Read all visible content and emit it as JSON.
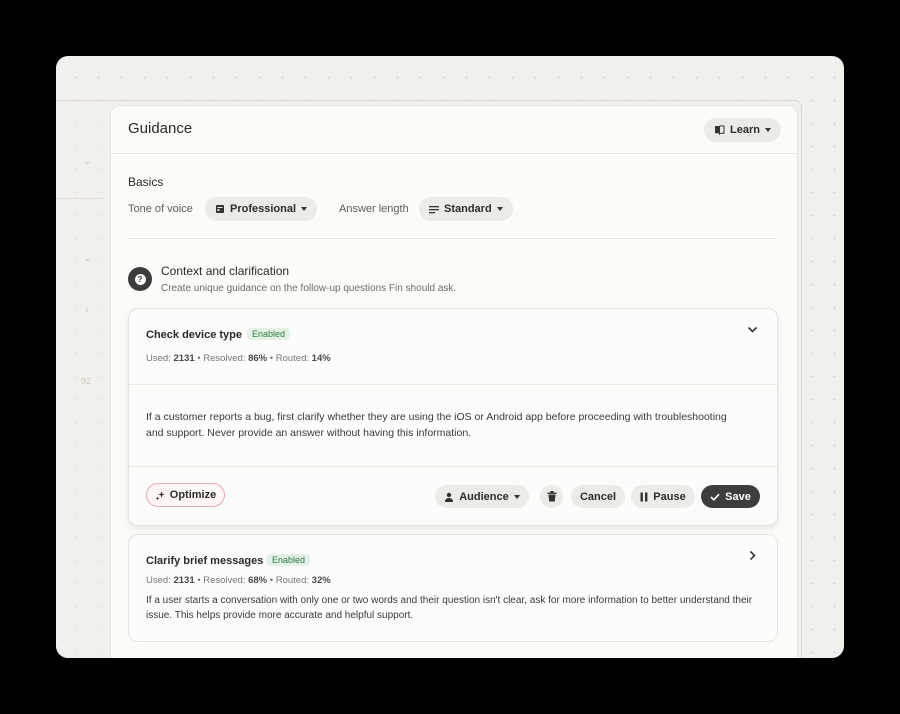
{
  "header": {
    "title": "Guidance",
    "learn_label": "Learn"
  },
  "basics": {
    "title": "Basics",
    "tone_label": "Tone of voice",
    "tone_value": "Professional",
    "length_label": "Answer length",
    "length_value": "Standard"
  },
  "context": {
    "title": "Context and clarification",
    "subtitle": "Create unique guidance on the follow-up questions Fin should ask."
  },
  "sidebar": {
    "number": "92"
  },
  "rules": [
    {
      "title": "Check device type",
      "status": "Enabled",
      "used_label": "Used:",
      "used_value": "2131",
      "resolved_label": "Resolved:",
      "resolved_value": "86%",
      "routed_label": "Routed:",
      "routed_value": "14%",
      "text": "If a customer reports a bug, first clarify whether they are using the iOS or Android app before proceeding with troubleshooting and support. Never provide an answer without having this information."
    },
    {
      "title": "Clarify brief messages",
      "status": "Enabled",
      "used_label": "Used:",
      "used_value": "2131",
      "resolved_label": "Resolved:",
      "resolved_value": "68%",
      "routed_label": "Routed:",
      "routed_value": "32%",
      "text": "If a user starts a conversation with only one or two words and their question isn't clear, ask for more information to better understand their issue. This helps provide more accurate and helpful support."
    }
  ],
  "actions": {
    "optimize": "Optimize",
    "audience": "Audience",
    "cancel": "Cancel",
    "pause": "Pause",
    "save": "Save"
  },
  "colors": {
    "accent_dark": "#3d3d3d",
    "enabled_green": "#2f7a42",
    "optimize_border": "#e7a9b4"
  }
}
